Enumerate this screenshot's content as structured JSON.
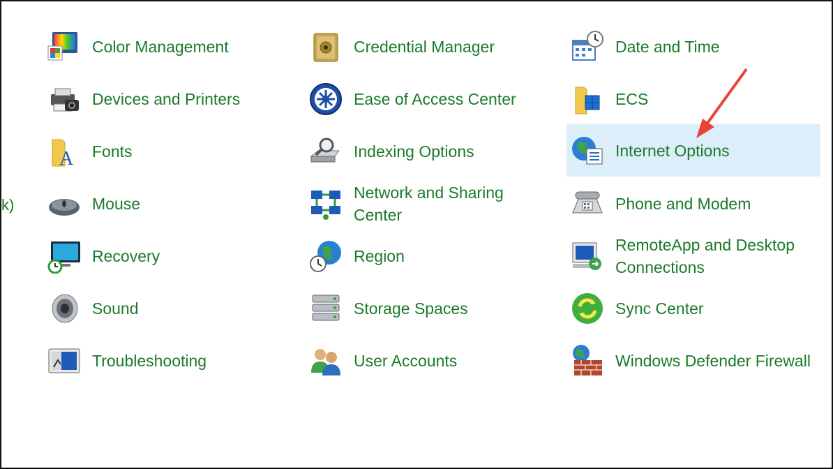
{
  "partial_left": {
    "row4": "k)"
  },
  "columns": [
    [
      {
        "label": "Color Management",
        "icon": "color-management-icon"
      },
      {
        "label": "Devices and Printers",
        "icon": "devices-printers-icon"
      },
      {
        "label": "Fonts",
        "icon": "fonts-icon"
      },
      {
        "label": "Mouse",
        "icon": "mouse-icon"
      },
      {
        "label": "Recovery",
        "icon": "recovery-icon"
      },
      {
        "label": "Sound",
        "icon": "sound-icon"
      },
      {
        "label": "Troubleshooting",
        "icon": "troubleshooting-icon"
      }
    ],
    [
      {
        "label": "Credential Manager",
        "icon": "credential-manager-icon"
      },
      {
        "label": "Ease of Access Center",
        "icon": "ease-of-access-icon"
      },
      {
        "label": "Indexing Options",
        "icon": "indexing-options-icon"
      },
      {
        "label": "Network and Sharing Center",
        "icon": "network-sharing-icon"
      },
      {
        "label": "Region",
        "icon": "region-icon"
      },
      {
        "label": "Storage Spaces",
        "icon": "storage-spaces-icon"
      },
      {
        "label": "User Accounts",
        "icon": "user-accounts-icon"
      }
    ],
    [
      {
        "label": "Date and Time",
        "icon": "date-time-icon"
      },
      {
        "label": "ECS",
        "icon": "ecs-folder-icon"
      },
      {
        "label": "Internet Options",
        "icon": "internet-options-icon",
        "selected": true
      },
      {
        "label": "Phone and Modem",
        "icon": "phone-modem-icon"
      },
      {
        "label": "RemoteApp and Desktop Connections",
        "icon": "remoteapp-icon"
      },
      {
        "label": "Sync Center",
        "icon": "sync-center-icon"
      },
      {
        "label": "Windows Defender Firewall",
        "icon": "firewall-icon"
      }
    ]
  ],
  "colors": {
    "label": "#1b7a2a",
    "selected_bg": "#ddeefb",
    "arrow": "#ea4335"
  }
}
